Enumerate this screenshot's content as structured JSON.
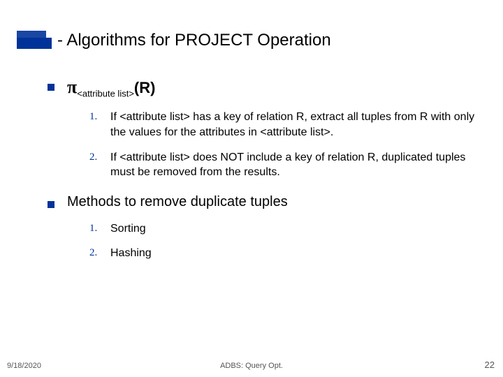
{
  "title": "- Algorithms for PROJECT Operation",
  "section1": {
    "operator": "π",
    "subscript": "<attribute list>",
    "arg": "(R)",
    "items": [
      {
        "num": "1.",
        "text": "If <attribute list> has a key of relation R, extract all tuples from R with only the values for the attributes in <attribute list>."
      },
      {
        "num": "2.",
        "text": "If <attribute list> does NOT include a key of relation R, duplicated tuples must be removed from the results."
      }
    ]
  },
  "section2": {
    "heading": "Methods to remove duplicate tuples",
    "items": [
      {
        "num": "1.",
        "text": "Sorting"
      },
      {
        "num": "2.",
        "text": "Hashing"
      }
    ]
  },
  "footer": {
    "date": "9/18/2020",
    "center": "ADBS: Query Opt.",
    "page": "22"
  }
}
